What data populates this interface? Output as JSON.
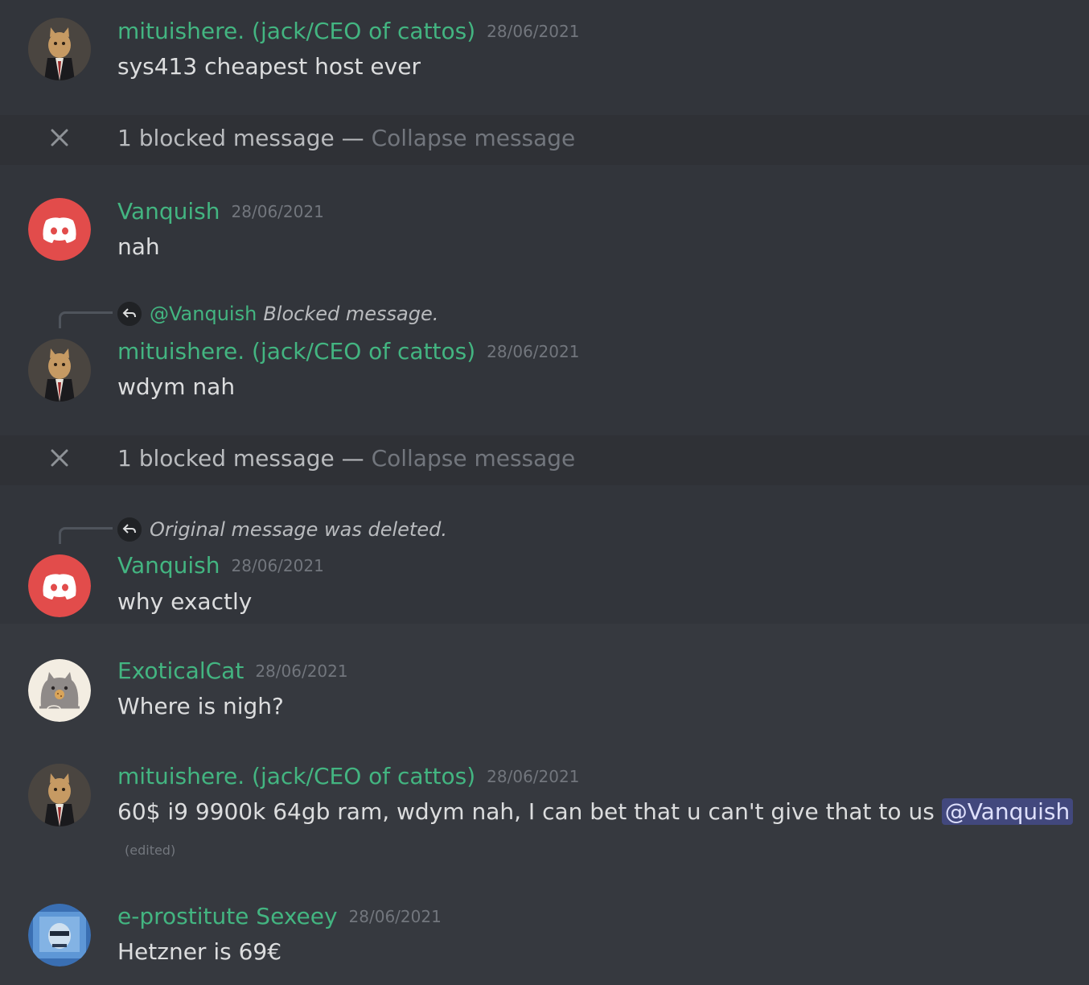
{
  "messages": [
    {
      "author": "mituishere. (jack/CEO of cattos)",
      "time": "28/06/2021",
      "text": "sys413 cheapest host ever"
    },
    {
      "author": "Vanquish",
      "time": "28/06/2021",
      "text": "nah"
    },
    {
      "author": "mituishere. (jack/CEO of cattos)",
      "time": "28/06/2021",
      "text": "wdym nah",
      "reply": {
        "author": "@Vanquish",
        "text": "Blocked message."
      }
    },
    {
      "author": "Vanquish",
      "time": "28/06/2021",
      "text": "why exactly",
      "reply": {
        "text": "Original message was deleted."
      }
    },
    {
      "author": "ExoticalCat",
      "time": "28/06/2021",
      "text": "Where is nigh?"
    },
    {
      "author": "mituishere. (jack/CEO of cattos)",
      "time": "28/06/2021",
      "text": "60$ i9 9900k 64gb ram, wdym nah, I can bet that u can't give that to us",
      "mention": "@Vanquish",
      "edited": "(edited)"
    },
    {
      "author": "e-prostitute Sexeey",
      "time": "28/06/2021",
      "text": "Hetzner is 69€"
    }
  ],
  "blocked": {
    "label": "1 blocked message —",
    "collapse": "Collapse message"
  },
  "colors": {
    "username": "#43b581",
    "background": "#36393f",
    "discord_red": "#e24c4b"
  }
}
